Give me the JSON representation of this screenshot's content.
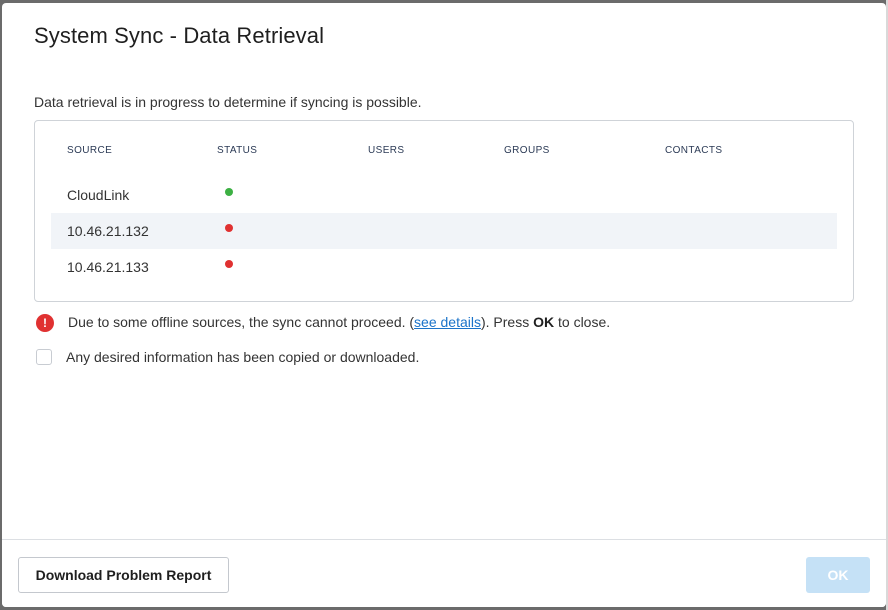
{
  "dialog": {
    "title": "System Sync - Data Retrieval",
    "intro": "Data retrieval is in progress to determine if syncing is possible."
  },
  "table": {
    "headers": {
      "source": "SOURCE",
      "status": "STATUS",
      "users": "USERS",
      "groups": "GROUPS",
      "contacts": "CONTACTS"
    },
    "rows": [
      {
        "source": "CloudLink",
        "status": "online",
        "status_color": "#3cb043"
      },
      {
        "source": "10.46.21.132",
        "status": "offline",
        "status_color": "#e03131"
      },
      {
        "source": "10.46.21.133",
        "status": "offline",
        "status_color": "#e03131"
      }
    ]
  },
  "message": {
    "icon": "error-icon",
    "icon_glyph": "!",
    "text_before": "Due to some offline sources, the sync cannot proceed. (",
    "link_text": "see details",
    "text_middle": "). Press ",
    "bold_text": "OK",
    "text_after": " to close."
  },
  "confirmation": {
    "checked": false,
    "label": "Any desired information has been copied or downloaded."
  },
  "footer": {
    "download_label": "Download Problem Report",
    "ok_label": "OK",
    "ok_disabled": true
  },
  "colors": {
    "online": "#3cb043",
    "offline": "#e03131",
    "link": "#1a73c9",
    "ok_disabled_bg": "#c5e1f6"
  }
}
